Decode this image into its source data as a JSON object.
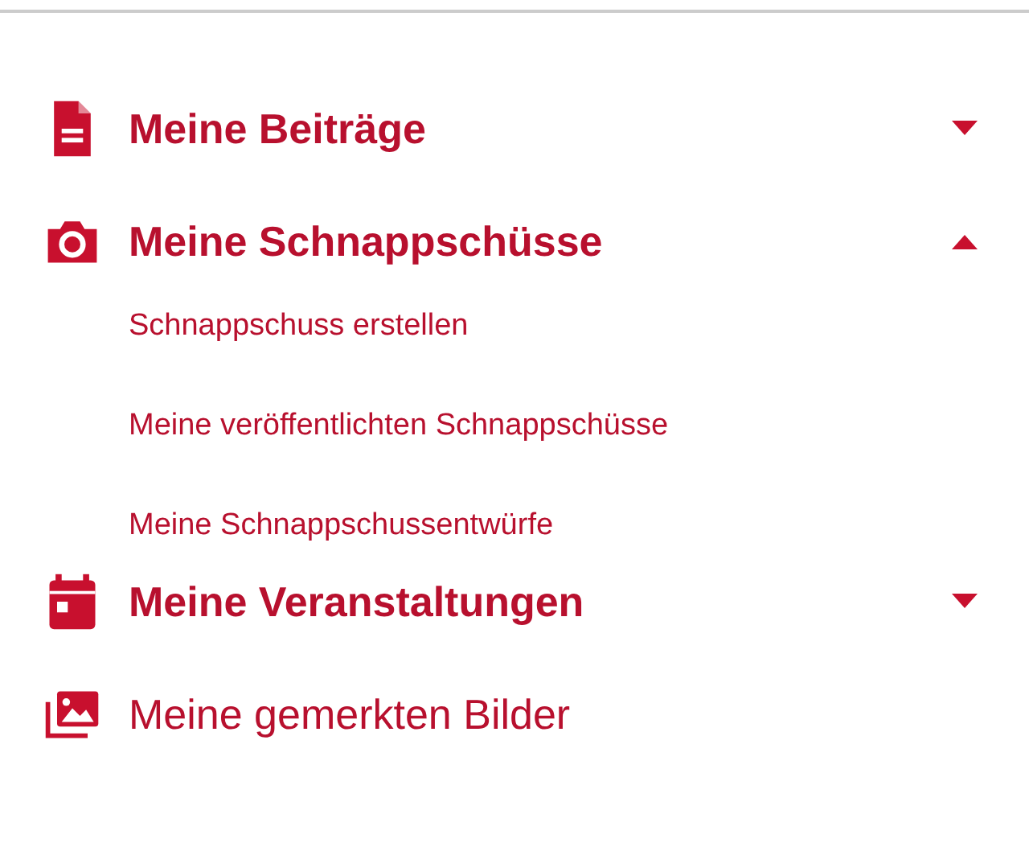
{
  "menu": [
    {
      "kind": "group",
      "label": "Meine Beiträge",
      "expanded": false
    },
    {
      "kind": "group",
      "label": "Meine Schnappschüsse",
      "expanded": true,
      "children": [
        {
          "label": "Schnappschuss erstellen"
        },
        {
          "label": "Meine veröffentlichten Schnappschüsse"
        },
        {
          "label": "Meine Schnappschussentwürfe"
        }
      ]
    },
    {
      "kind": "group",
      "label": "Meine Veranstaltungen",
      "expanded": false
    },
    {
      "kind": "link",
      "label": "Meine gemerkten Bilder"
    }
  ]
}
